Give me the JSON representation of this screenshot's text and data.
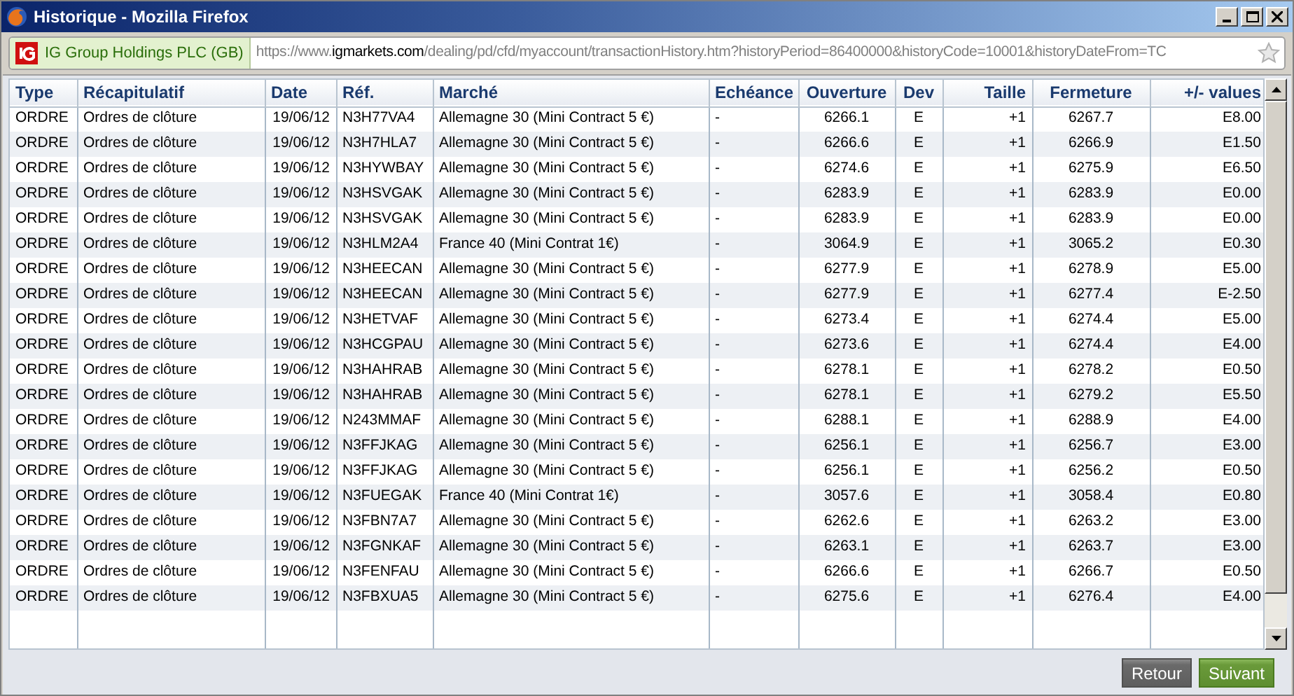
{
  "window": {
    "title": "Historique - Mozilla Firefox"
  },
  "address_bar": {
    "site_badge": "IG Group Holdings PLC (GB)",
    "url_prefix": "https://www.",
    "url_domain": "igmarkets.com",
    "url_path": "/dealing/pd/cfd/myaccount/transactionHistory.htm?historyPeriod=86400000&historyCode=10001&historyDateFrom=TC"
  },
  "table": {
    "columns": [
      "Type",
      "Récapitulatif",
      "Date",
      "Réf.",
      "Marché",
      "Echéance",
      "Ouverture",
      "Dev",
      "Taille",
      "Fermeture",
      "+/- values"
    ],
    "rows": [
      [
        "ORDRE",
        "Ordres de clôture",
        "19/06/12",
        "N3H77VA4",
        "Allemagne 30 (Mini Contract 5 €)",
        "-",
        "6266.1",
        "E",
        "+1",
        "6267.7",
        "E8.00"
      ],
      [
        "ORDRE",
        "Ordres de clôture",
        "19/06/12",
        "N3H7HLA7",
        "Allemagne 30 (Mini Contract 5 €)",
        "-",
        "6266.6",
        "E",
        "+1",
        "6266.9",
        "E1.50"
      ],
      [
        "ORDRE",
        "Ordres de clôture",
        "19/06/12",
        "N3HYWBAY",
        "Allemagne 30 (Mini Contract 5 €)",
        "-",
        "6274.6",
        "E",
        "+1",
        "6275.9",
        "E6.50"
      ],
      [
        "ORDRE",
        "Ordres de clôture",
        "19/06/12",
        "N3HSVGAK",
        "Allemagne 30 (Mini Contract 5 €)",
        "-",
        "6283.9",
        "E",
        "+1",
        "6283.9",
        "E0.00"
      ],
      [
        "ORDRE",
        "Ordres de clôture",
        "19/06/12",
        "N3HSVGAK",
        "Allemagne 30 (Mini Contract 5 €)",
        "-",
        "6283.9",
        "E",
        "+1",
        "6283.9",
        "E0.00"
      ],
      [
        "ORDRE",
        "Ordres de clôture",
        "19/06/12",
        "N3HLM2A4",
        "France 40 (Mini Contrat 1€)",
        "-",
        "3064.9",
        "E",
        "+1",
        "3065.2",
        "E0.30"
      ],
      [
        "ORDRE",
        "Ordres de clôture",
        "19/06/12",
        "N3HEECAN",
        "Allemagne 30 (Mini Contract 5 €)",
        "-",
        "6277.9",
        "E",
        "+1",
        "6278.9",
        "E5.00"
      ],
      [
        "ORDRE",
        "Ordres de clôture",
        "19/06/12",
        "N3HEECAN",
        "Allemagne 30 (Mini Contract 5 €)",
        "-",
        "6277.9",
        "E",
        "+1",
        "6277.4",
        "E-2.50"
      ],
      [
        "ORDRE",
        "Ordres de clôture",
        "19/06/12",
        "N3HETVAF",
        "Allemagne 30 (Mini Contract 5 €)",
        "-",
        "6273.4",
        "E",
        "+1",
        "6274.4",
        "E5.00"
      ],
      [
        "ORDRE",
        "Ordres de clôture",
        "19/06/12",
        "N3HCGPAU",
        "Allemagne 30 (Mini Contract 5 €)",
        "-",
        "6273.6",
        "E",
        "+1",
        "6274.4",
        "E4.00"
      ],
      [
        "ORDRE",
        "Ordres de clôture",
        "19/06/12",
        "N3HAHRAB",
        "Allemagne 30 (Mini Contract 5 €)",
        "-",
        "6278.1",
        "E",
        "+1",
        "6278.2",
        "E0.50"
      ],
      [
        "ORDRE",
        "Ordres de clôture",
        "19/06/12",
        "N3HAHRAB",
        "Allemagne 30 (Mini Contract 5 €)",
        "-",
        "6278.1",
        "E",
        "+1",
        "6279.2",
        "E5.50"
      ],
      [
        "ORDRE",
        "Ordres de clôture",
        "19/06/12",
        "N243MMAF",
        "Allemagne 30 (Mini Contract 5 €)",
        "-",
        "6288.1",
        "E",
        "+1",
        "6288.9",
        "E4.00"
      ],
      [
        "ORDRE",
        "Ordres de clôture",
        "19/06/12",
        "N3FFJKAG",
        "Allemagne 30 (Mini Contract 5 €)",
        "-",
        "6256.1",
        "E",
        "+1",
        "6256.7",
        "E3.00"
      ],
      [
        "ORDRE",
        "Ordres de clôture",
        "19/06/12",
        "N3FFJKAG",
        "Allemagne 30 (Mini Contract 5 €)",
        "-",
        "6256.1",
        "E",
        "+1",
        "6256.2",
        "E0.50"
      ],
      [
        "ORDRE",
        "Ordres de clôture",
        "19/06/12",
        "N3FUEGAK",
        "France 40 (Mini Contrat 1€)",
        "-",
        "3057.6",
        "E",
        "+1",
        "3058.4",
        "E0.80"
      ],
      [
        "ORDRE",
        "Ordres de clôture",
        "19/06/12",
        "N3FBN7A7",
        "Allemagne 30 (Mini Contract 5 €)",
        "-",
        "6262.6",
        "E",
        "+1",
        "6263.2",
        "E3.00"
      ],
      [
        "ORDRE",
        "Ordres de clôture",
        "19/06/12",
        "N3FGNKAF",
        "Allemagne 30 (Mini Contract 5 €)",
        "-",
        "6263.1",
        "E",
        "+1",
        "6263.7",
        "E3.00"
      ],
      [
        "ORDRE",
        "Ordres de clôture",
        "19/06/12",
        "N3FENFAU",
        "Allemagne 30 (Mini Contract 5 €)",
        "-",
        "6266.6",
        "E",
        "+1",
        "6266.7",
        "E0.50"
      ],
      [
        "ORDRE",
        "Ordres de clôture",
        "19/06/12",
        "N3FBXUA5",
        "Allemagne 30 (Mini Contract 5 €)",
        "-",
        "6275.6",
        "E",
        "+1",
        "6276.4",
        "E4.00"
      ]
    ]
  },
  "buttons": [
    {
      "label": "Retour",
      "kind": "secondary"
    },
    {
      "label": "Suivant",
      "kind": "primary"
    }
  ]
}
